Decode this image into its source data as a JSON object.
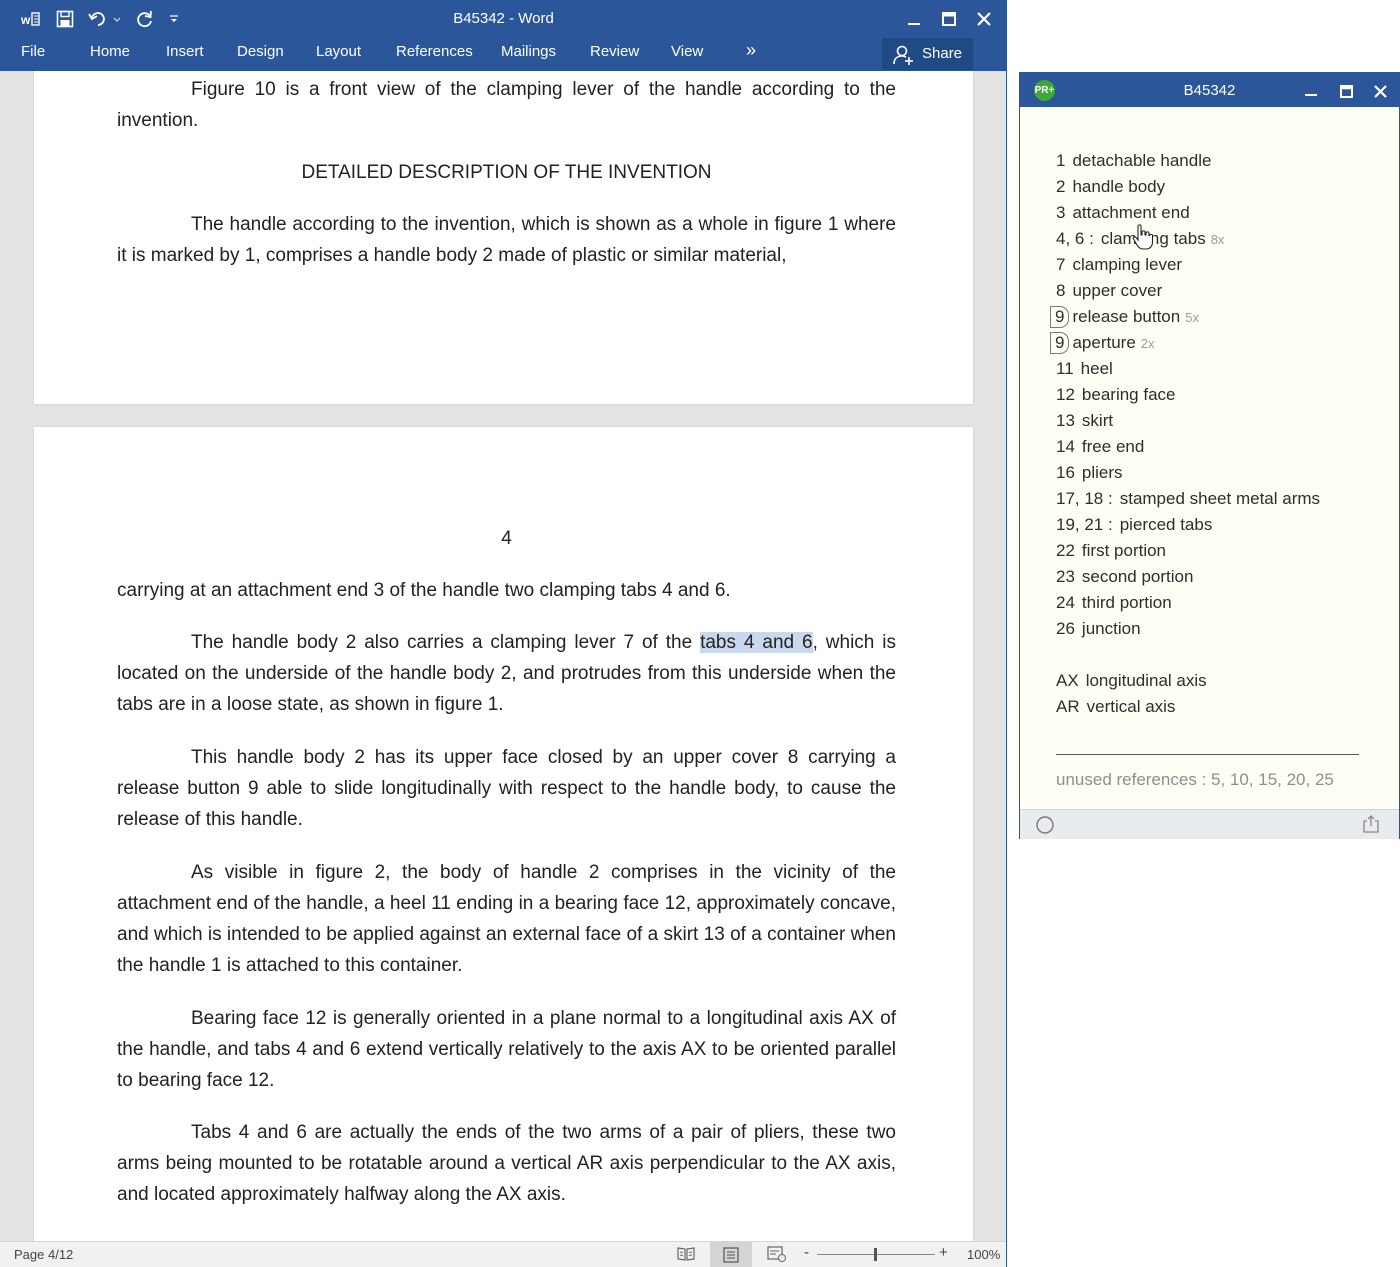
{
  "word": {
    "title": "B45342 - Word",
    "tabs": [
      "File",
      "Home",
      "Insert",
      "Design",
      "Layout",
      "References",
      "Mailings",
      "Review",
      "View"
    ],
    "more_glyph": "»",
    "share_label": "Share",
    "page1": {
      "p1": "Figure 10 is a front view of the clamping lever of the handle according to the invention.",
      "heading": "DETAILED DESCRIPTION OF THE INVENTION",
      "p2": "The handle according to the invention, which is shown as a whole in figure 1 where it is marked by 1, comprises a handle body 2 made of plastic or similar material,"
    },
    "page2": {
      "page_number": "4",
      "p1": "carrying at an attachment end 3 of the handle two clamping tabs 4 and 6.",
      "p2_before": "The handle body 2 also carries a clamping lever 7 of the ",
      "p2_highlight": "tabs 4 and 6",
      "p2_after": ", which is located on the underside of the handle body 2, and protrudes from this underside when the tabs are in a loose state, as shown in figure 1.",
      "p3": "This handle body 2 has its upper face closed by an upper cover 8 carrying a release button 9 able to slide longitudinally with respect to the handle body, to cause the release of this handle.",
      "p4": "As visible in figure 2, the body of handle 2 comprises in the vicinity of the attachment end of the handle, a heel 11 ending in a bearing face 12, approximately concave, and which is intended to be applied against an external face of a skirt 13 of a container when the handle 1 is attached to this container.",
      "p5": "Bearing face 12 is generally oriented in a plane normal to a longitudinal axis AX of the handle, and tabs 4 and 6 extend vertically relatively to the axis AX to be oriented parallel to bearing face 12.",
      "p6": "Tabs 4 and 6 are actually the ends of the two arms of a pair of pliers, these two arms being mounted to be rotatable around a vertical AR axis perpendicular to the AX axis, and located approximately halfway along the AX axis."
    },
    "status": {
      "page": "Page 4/12",
      "zoom": "100%",
      "zoom_minus": "-",
      "zoom_plus": "+"
    }
  },
  "panel": {
    "title": "B45342",
    "logo_text": "PR+",
    "references": [
      {
        "num": "1",
        "label": "detachable handle",
        "count": ""
      },
      {
        "num": "2",
        "label": "handle body",
        "count": ""
      },
      {
        "num": "3",
        "label": "attachment end",
        "count": ""
      },
      {
        "num": "4, 6 :",
        "label": "clamping tabs",
        "count": "8x"
      },
      {
        "num": "7",
        "label": "clamping lever",
        "count": ""
      },
      {
        "num": "8",
        "label": "upper cover",
        "count": ""
      },
      {
        "num": "9",
        "label": "release button",
        "count": "5x",
        "boxed": true
      },
      {
        "num": "9",
        "label": "aperture",
        "count": "2x",
        "boxed": true
      },
      {
        "num": "11",
        "label": "heel",
        "count": ""
      },
      {
        "num": "12",
        "label": "bearing face",
        "count": ""
      },
      {
        "num": "13",
        "label": "skirt",
        "count": ""
      },
      {
        "num": "14",
        "label": "free end",
        "count": ""
      },
      {
        "num": "16",
        "label": "pliers",
        "count": ""
      },
      {
        "num": "17, 18 :",
        "label": "stamped sheet metal arms",
        "count": ""
      },
      {
        "num": "19, 21 :",
        "label": "pierced tabs",
        "count": ""
      },
      {
        "num": "22",
        "label": "first portion",
        "count": ""
      },
      {
        "num": "23",
        "label": "second portion",
        "count": ""
      },
      {
        "num": "24",
        "label": "third portion",
        "count": ""
      },
      {
        "num": "26",
        "label": "junction",
        "count": ""
      }
    ],
    "axes": [
      {
        "num": "AX",
        "label": "longitudinal axis"
      },
      {
        "num": "AR",
        "label": "vertical axis"
      }
    ],
    "unused": "unused references : 5, 10, 15, 20, 25"
  },
  "colors": {
    "word_blue": "#2b579a",
    "highlight": "#c9d8ee",
    "panel_bg": "#fffef5",
    "logo_green": "#3aa935"
  }
}
